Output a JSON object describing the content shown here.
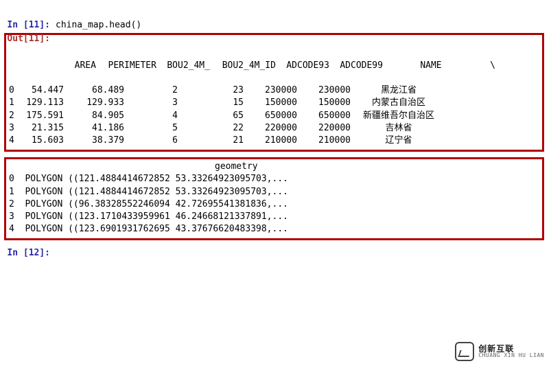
{
  "cells": {
    "input_11": {
      "n": "11",
      "code": "china_map.head()"
    },
    "output_11_label": {
      "n": "11"
    },
    "input_12": {
      "n": "12",
      "code": ""
    }
  },
  "table1": {
    "columns": [
      "AREA",
      "PERIMETER",
      "BOU2_4M_",
      "BOU2_4M_ID",
      "ADCODE93",
      "ADCODE99",
      "NAME"
    ],
    "continuation": "\\",
    "rows": [
      {
        "idx": "0",
        "area": "54.447",
        "perimeter": "68.489",
        "bou2_4m": "2",
        "bou2_4m_id": "23",
        "adcode93": "230000",
        "adcode99": "230000",
        "name": "黑龙江省"
      },
      {
        "idx": "1",
        "area": "129.113",
        "perimeter": "129.933",
        "bou2_4m": "3",
        "bou2_4m_id": "15",
        "adcode93": "150000",
        "adcode99": "150000",
        "name": "内蒙古自治区"
      },
      {
        "idx": "2",
        "area": "175.591",
        "perimeter": "84.905",
        "bou2_4m": "4",
        "bou2_4m_id": "65",
        "adcode93": "650000",
        "adcode99": "650000",
        "name": "新疆维吾尔自治区"
      },
      {
        "idx": "3",
        "area": "21.315",
        "perimeter": "41.186",
        "bou2_4m": "5",
        "bou2_4m_id": "22",
        "adcode93": "220000",
        "adcode99": "220000",
        "name": "吉林省"
      },
      {
        "idx": "4",
        "area": "15.603",
        "perimeter": "38.379",
        "bou2_4m": "6",
        "bou2_4m_id": "21",
        "adcode93": "210000",
        "adcode99": "210000",
        "name": "辽宁省"
      }
    ]
  },
  "table2": {
    "column": "geometry",
    "rows": [
      {
        "idx": "0",
        "geom": "POLYGON ((121.4884414672852 53.33264923095703,..."
      },
      {
        "idx": "1",
        "geom": "POLYGON ((121.4884414672852 53.33264923095703,..."
      },
      {
        "idx": "2",
        "geom": "POLYGON ((96.38328552246094 42.72695541381836,..."
      },
      {
        "idx": "3",
        "geom": "POLYGON ((123.1710433959961 46.24668121337891,..."
      },
      {
        "idx": "4",
        "geom": "POLYGON ((123.6901931762695 43.37676620483398,..."
      }
    ]
  },
  "watermark": {
    "cn": "创新互联",
    "en": "CHUANG XIN HU LIAN"
  }
}
